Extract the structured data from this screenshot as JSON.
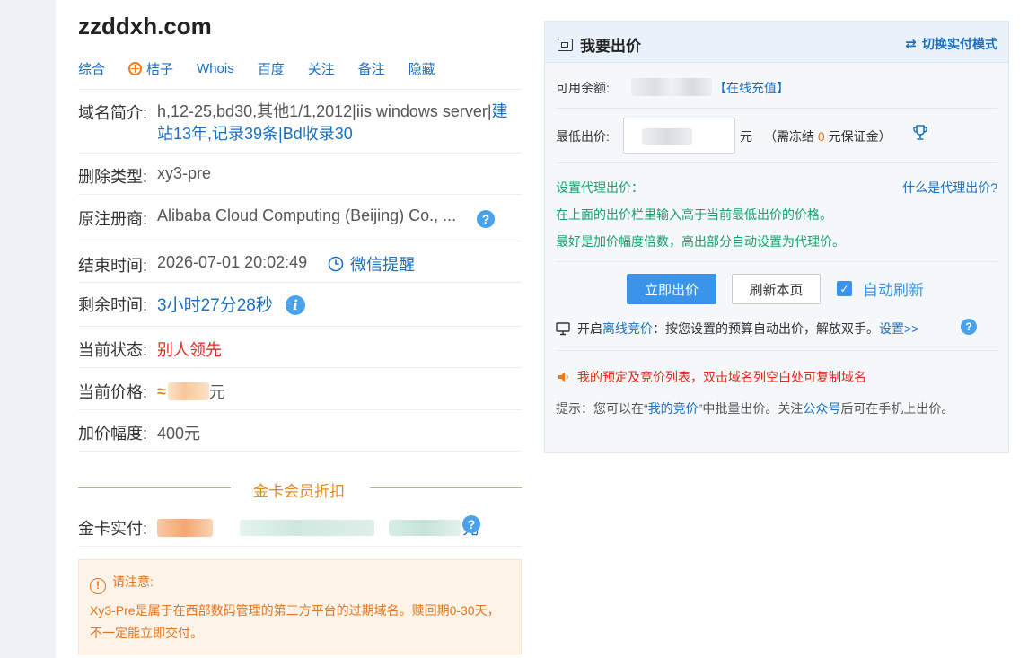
{
  "domain": "zzddxh.com",
  "tabs": [
    {
      "label": "综合"
    },
    {
      "label": "桔子",
      "icon": "orange-icon"
    },
    {
      "label": "Whois"
    },
    {
      "label": "百度"
    },
    {
      "label": "关注"
    },
    {
      "label": "备注"
    },
    {
      "label": "隐藏"
    }
  ],
  "info": {
    "intro_label": "域名简介:",
    "intro_plain": "h,12-25,bd30,其他1/1,2012|iis windows server|",
    "intro_link_1": "建",
    "intro_link_2": "站13年,记录39条|Bd收录30",
    "delete_type_label": "删除类型:",
    "delete_type": "xy3-pre",
    "registrar_label": "原注册商:",
    "registrar": "Alibaba Cloud Computing (Beijing) Co., ...",
    "end_time_label": "结束时间:",
    "end_time": "2026-07-01 20:02:49",
    "wechat_remind": "微信提醒",
    "remaining_label": "剩余时间:",
    "remaining": "3小时27分28秒",
    "status_label": "当前状态:",
    "status": "别人领先",
    "price_label": "当前价格:",
    "price_prefix": "≈",
    "price_suffix": "元",
    "increment_label": "加价幅度:",
    "increment": "400元"
  },
  "gold": {
    "divider": "金卡会员折扣",
    "label": "金卡实付:",
    "suffix": "元"
  },
  "notice": {
    "title": "请注意:",
    "body": "Xy3-Pre是属于在西部数码管理的第三方平台的过期域名。赎回期0-30天，不一定能立即交付。"
  },
  "panel": {
    "title": "我要出价",
    "switch": "切换实付模式",
    "balance_label": "可用余额:",
    "recharge": "【在线充值】",
    "min_bid_label": "最低出价:",
    "yuan": "元",
    "freeze_pre": "（需冻结",
    "freeze_amount": "0",
    "freeze_post": "元保证金）",
    "proxy_label": "设置代理出价：",
    "proxy_help": "什么是代理出价?",
    "proxy_tip1": "在上面的出价栏里输入高于当前最低出价的价格。",
    "proxy_tip2": "最好是加价幅度倍数，高出部分自动设置为代理价。",
    "bid_button": "立即出价",
    "refresh_button": "刷新本页",
    "auto_refresh": "自动刷新",
    "offline_pre": "开启",
    "offline_link": "离线竞价",
    "offline_post": "：按您设置的预算自动出价，解放双手。",
    "settings_link": "设置>>",
    "my_list": "我的预定及竞价列表，双击域名列空白处可复制域名",
    "hint_pre": "提示：您可以在",
    "hint_quote_open": "“",
    "hint_link": "我的竞价",
    "hint_quote_close": "”",
    "hint_mid": "中批量出价。关注",
    "hint_link2": "公众号",
    "hint_post": "后可在手机上出价。"
  },
  "colors": {
    "link": "#1a6fc2",
    "accent": "#3a95ea",
    "danger": "#e0281c",
    "gold": "#e08a22",
    "green": "#16a06a"
  }
}
